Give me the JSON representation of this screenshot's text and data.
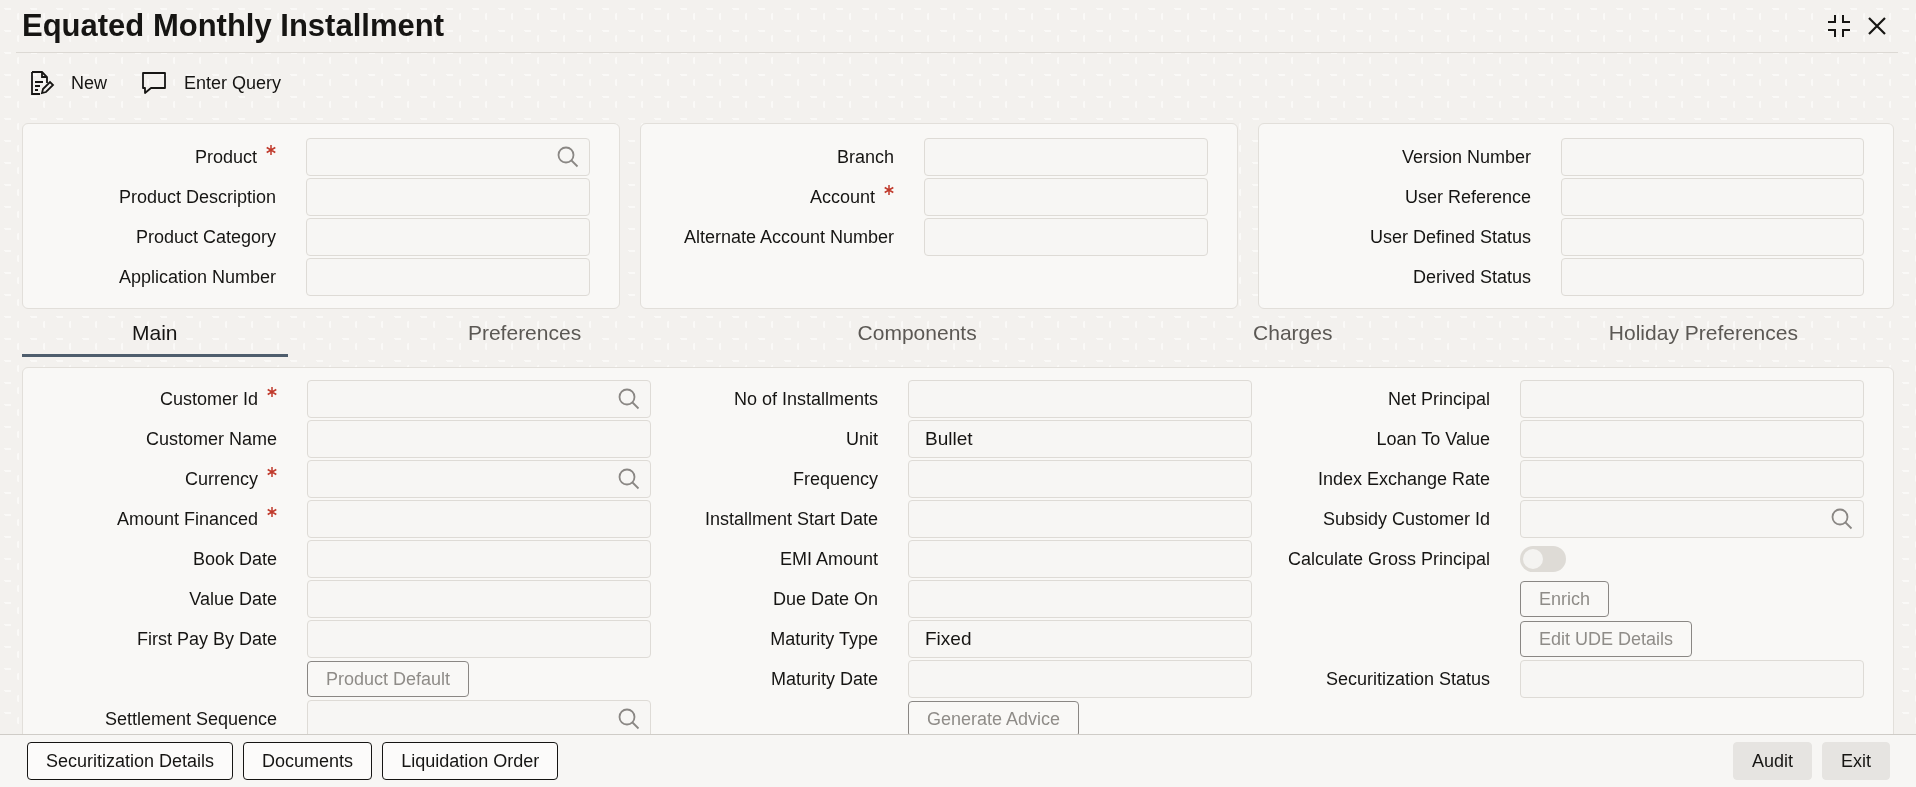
{
  "window": {
    "title": "Equated Monthly Installment"
  },
  "toolbar": [
    {
      "kind": "new",
      "label": "New"
    },
    {
      "kind": "query",
      "label": "Enter Query"
    }
  ],
  "header_panels": [
    {
      "fields": [
        {
          "kind": "lookup",
          "label": "Product",
          "required": true
        },
        {
          "kind": "text",
          "label": "Product Description",
          "required": false
        },
        {
          "kind": "text",
          "label": "Product Category",
          "required": false
        },
        {
          "kind": "text",
          "label": "Application Number",
          "required": false
        }
      ]
    },
    {
      "fields": [
        {
          "kind": "text",
          "label": "Branch",
          "required": false
        },
        {
          "kind": "text",
          "label": "Account",
          "required": true
        },
        {
          "kind": "text",
          "label": "Alternate Account Number",
          "required": false
        }
      ]
    },
    {
      "fields": [
        {
          "kind": "text",
          "label": "Version Number",
          "required": false
        },
        {
          "kind": "text",
          "label": "User Reference",
          "required": false
        },
        {
          "kind": "text",
          "label": "User Defined Status",
          "required": false
        },
        {
          "kind": "text",
          "label": "Derived Status",
          "required": false
        }
      ]
    }
  ],
  "tabs": [
    {
      "label": "Main",
      "selected": true
    },
    {
      "label": "Preferences",
      "selected": false
    },
    {
      "label": "Components",
      "selected": false
    },
    {
      "label": "Charges",
      "selected": false
    },
    {
      "label": "Holiday Preferences",
      "selected": false
    }
  ],
  "main_columns": [
    {
      "fields": [
        {
          "kind": "lookup",
          "label": "Customer Id",
          "required": true
        },
        {
          "kind": "text",
          "label": "Customer Name",
          "required": false
        },
        {
          "kind": "lookup",
          "label": "Currency",
          "required": true
        },
        {
          "kind": "text",
          "label": "Amount Financed",
          "required": true
        },
        {
          "kind": "text",
          "label": "Book Date",
          "required": false
        },
        {
          "kind": "text",
          "label": "Value Date",
          "required": false
        },
        {
          "kind": "text",
          "label": "First Pay By Date",
          "required": false
        },
        {
          "kind": "button",
          "label": "Product Default",
          "disabled": true
        },
        {
          "kind": "lookup",
          "label": "Settlement Sequence",
          "required": false
        }
      ]
    },
    {
      "fields": [
        {
          "kind": "text",
          "label": "No of Installments",
          "required": false
        },
        {
          "kind": "text",
          "label": "Unit",
          "required": false,
          "value": "Bullet"
        },
        {
          "kind": "text",
          "label": "Frequency",
          "required": false
        },
        {
          "kind": "text",
          "label": "Installment Start Date",
          "required": false
        },
        {
          "kind": "text",
          "label": "EMI Amount",
          "required": false
        },
        {
          "kind": "text",
          "label": "Due Date On",
          "required": false
        },
        {
          "kind": "text",
          "label": "Maturity Type",
          "required": false,
          "value": "Fixed"
        },
        {
          "kind": "text",
          "label": "Maturity Date",
          "required": false
        },
        {
          "kind": "button",
          "label": "Generate Advice",
          "disabled": true
        }
      ]
    },
    {
      "fields": [
        {
          "kind": "text",
          "label": "Net Principal",
          "required": false
        },
        {
          "kind": "text",
          "label": "Loan To Value",
          "required": false
        },
        {
          "kind": "text",
          "label": "Index Exchange Rate",
          "required": false
        },
        {
          "kind": "lookup",
          "label": "Subsidy Customer Id",
          "required": false
        },
        {
          "kind": "toggle",
          "label": "Calculate Gross Principal",
          "on": false
        },
        {
          "kind": "button",
          "label": "Enrich",
          "disabled": true
        },
        {
          "kind": "button",
          "label": "Edit UDE Details",
          "disabled": true
        },
        {
          "kind": "text",
          "label": "Securitization Status",
          "required": false
        }
      ]
    }
  ],
  "footer": {
    "left": [
      {
        "label": "Securitization Details",
        "disabled": false
      },
      {
        "label": "Documents",
        "disabled": false
      },
      {
        "label": "Liquidation Order",
        "disabled": false
      }
    ],
    "right": [
      {
        "label": "Audit",
        "disabled": true
      },
      {
        "label": "Exit",
        "disabled": true
      }
    ]
  }
}
